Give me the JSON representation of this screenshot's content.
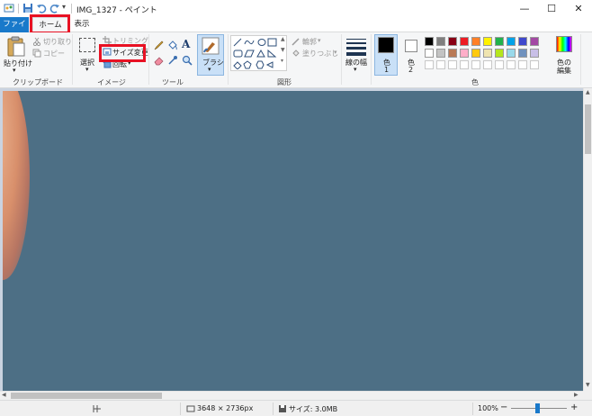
{
  "window": {
    "title": "IMG_1327 - ペイント",
    "minimize_glyph": "—",
    "maximize_glyph": "☐",
    "close_glyph": "✕"
  },
  "tabs": [
    {
      "label": "ファイル",
      "state": "file-menu"
    },
    {
      "label": "ホーム",
      "state": "selected"
    },
    {
      "label": "表示",
      "state": "normal"
    }
  ],
  "ribbon": {
    "clipboard": {
      "group_label": "クリップボード",
      "paste": "貼り付け",
      "cut": "切り取り",
      "copy": "コピー"
    },
    "image": {
      "group_label": "イメージ",
      "select": "選択",
      "crop": "トリミング",
      "resize": "サイズ変更",
      "rotate": "回転"
    },
    "tools": {
      "group_label": "ツール",
      "brushes": "ブラシ",
      "text_tool_glyph": "A"
    },
    "shapes": {
      "group_label": "図形",
      "outline": "輪郭",
      "fill": "塗りつぶし"
    },
    "size_label": "線の幅",
    "colors": {
      "group_label": "色",
      "color1": "色\n1",
      "color1_a": "色",
      "color1_b": "1",
      "color2_a": "色",
      "color2_b": "2",
      "edit_a": "色の",
      "edit_b": "編集",
      "color1_value": "#000000",
      "color2_value": "#ffffff",
      "palette_row1": [
        "#000000",
        "#7f7f7f",
        "#880015",
        "#ed1c24",
        "#ff7f27",
        "#fff200",
        "#22b14c",
        "#00a2e8",
        "#3f48cc",
        "#a349a4"
      ],
      "palette_row2": [
        "#ffffff",
        "#c3c3c3",
        "#b97a57",
        "#ffaec9",
        "#ffc90e",
        "#efe4b0",
        "#b5e61d",
        "#99d9ea",
        "#7092be",
        "#c8bfe7"
      ]
    }
  },
  "status": {
    "dimensions": "3648 × 2736px",
    "size": "サイズ: 3.0MB",
    "zoom": "100%",
    "zoom_minus": "−",
    "zoom_plus": "+"
  },
  "highlight_color": "#e81123"
}
